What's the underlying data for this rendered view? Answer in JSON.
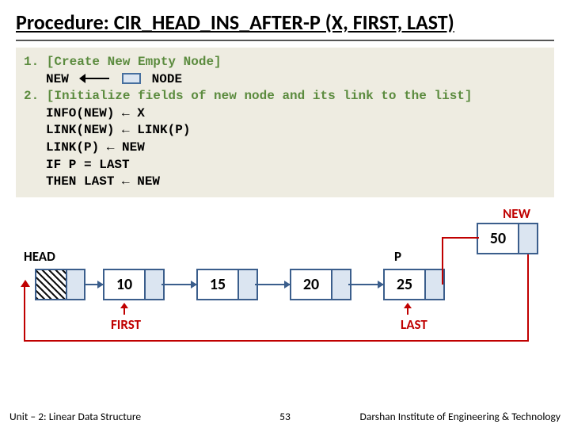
{
  "title": "Procedure: CIR_HEAD_INS_AFTER-P (X, FIRST, LAST)",
  "steps": {
    "s1_head": "1. [Create New Empty Node]",
    "s1_l1a": "NEW",
    "s1_l1b": "NODE",
    "s2_head": "2. [Initialize fields of new node and its link to the list]",
    "s2_l1": "INFO(NEW) ← X",
    "s2_l2": "LINK(NEW) ← LINK(P)",
    "s2_l3": "LINK(P) ← NEW",
    "s2_l4": "IF   P = LAST",
    "s2_l5": "THEN LAST ← NEW"
  },
  "labels": {
    "new": "NEW",
    "head": "HEAD",
    "p": "P",
    "first": "FIRST",
    "last": "LAST"
  },
  "nodes": {
    "new_val": "50",
    "n1": "10",
    "n2": "15",
    "n3": "20",
    "n4": "25"
  },
  "footer": {
    "unit": "Unit – 2: Linear Data Structure",
    "page": "53",
    "inst": "Darshan Institute of Engineering & Technology"
  }
}
